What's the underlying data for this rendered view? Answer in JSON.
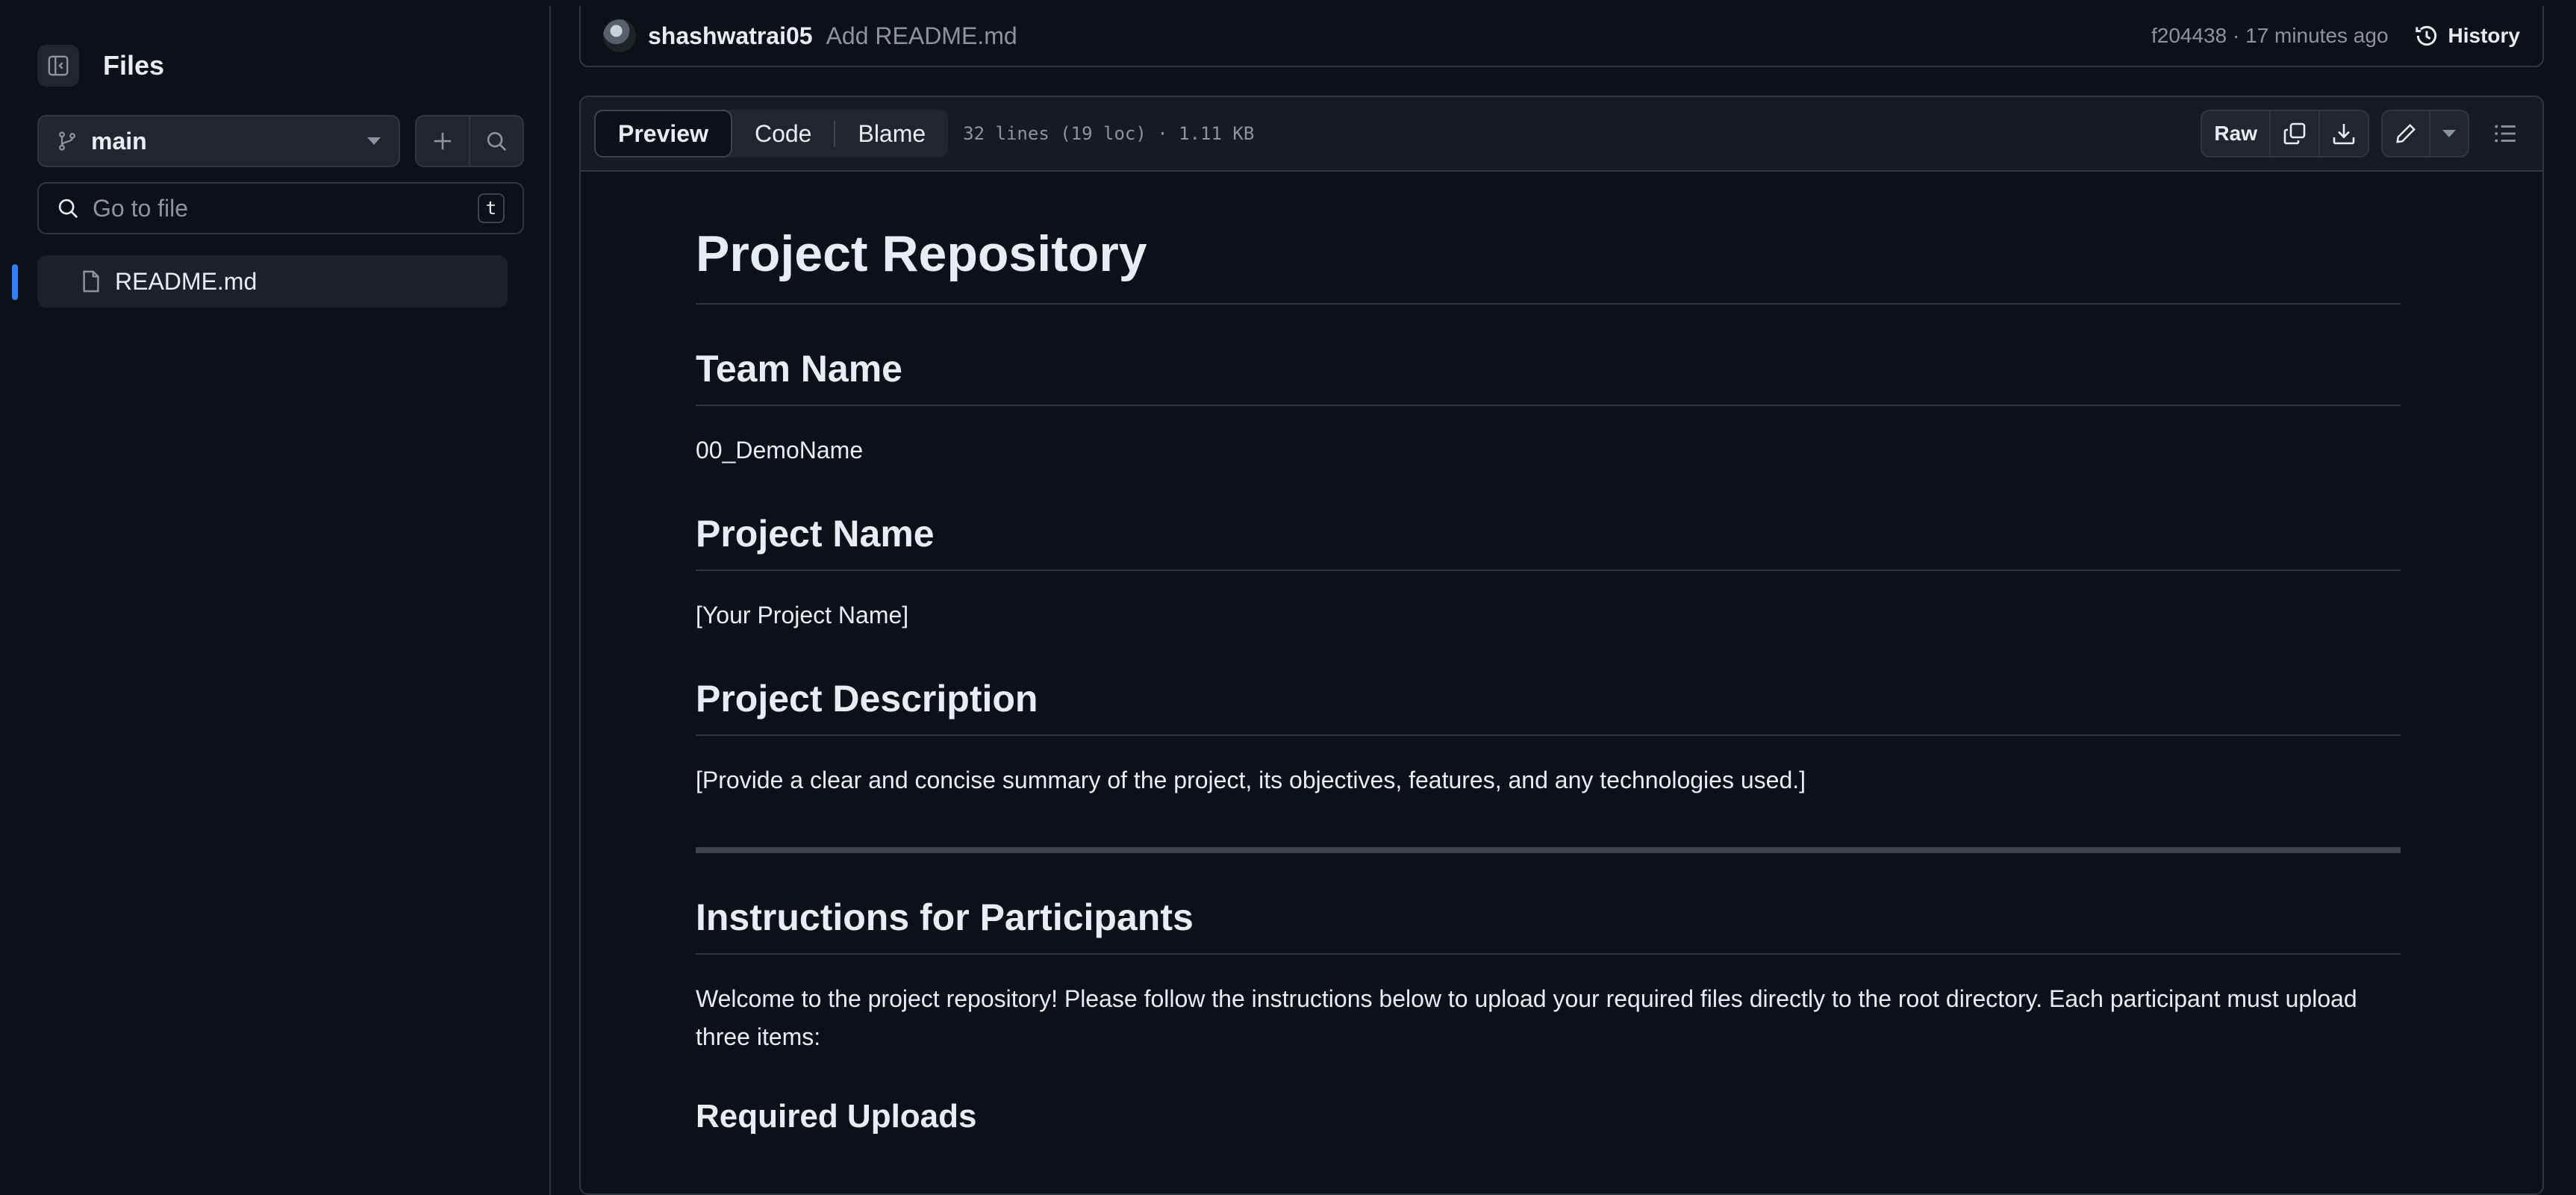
{
  "sidebar": {
    "title": "Files",
    "branch": "main",
    "goto_placeholder": "Go to file",
    "goto_shortcut": "t",
    "tree": [
      {
        "label": "README.md",
        "active": true
      }
    ]
  },
  "commit": {
    "user": "shashwatrai05",
    "message": "Add README.md",
    "meta": "f204438 · 17 minutes ago",
    "history_label": "History"
  },
  "file_toolbar": {
    "tabs": [
      "Preview",
      "Code",
      "Blame"
    ],
    "active_tab": "Preview",
    "stats": "32 lines (19 loc) · 1.11 KB",
    "raw_label": "Raw"
  },
  "readme": {
    "h1": "Project Repository",
    "team_heading": "Team Name",
    "team_value": "00_DemoName",
    "project_heading": "Project Name",
    "project_value": "[Your Project Name]",
    "desc_heading": "Project Description",
    "desc_value": "[Provide a clear and concise summary of the project, its objectives, features, and any technologies used.]",
    "instructions_heading": "Instructions for Participants",
    "instructions_text": "Welcome to the project repository! Please follow the instructions below to upload your required files directly to the root directory. Each participant must upload three items:",
    "uploads_heading": "Required Uploads"
  },
  "colors": {
    "accent": "#2f81f7",
    "background": "#0d1117",
    "border": "#30363d"
  }
}
